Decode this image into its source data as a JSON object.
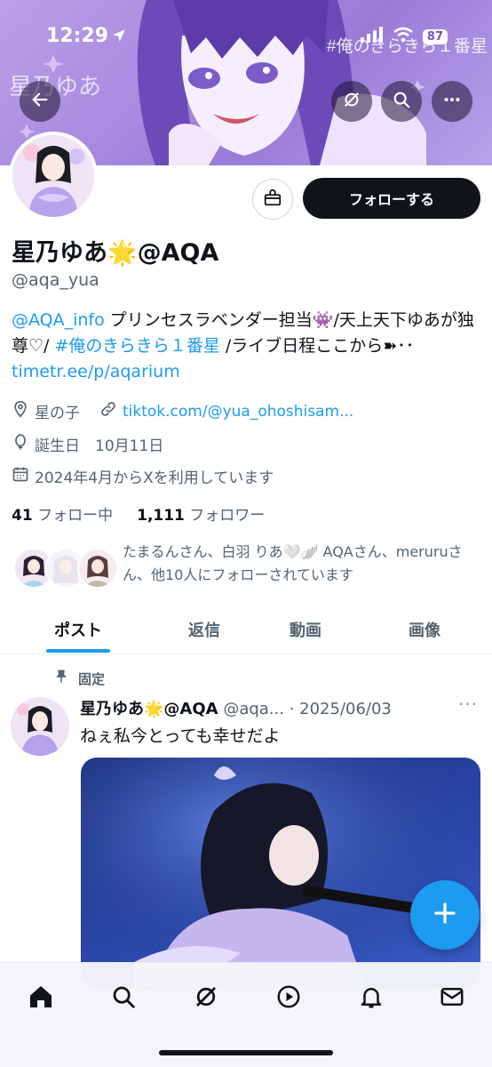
{
  "status_bar": {
    "time": "12:29",
    "battery": "87"
  },
  "profile": {
    "display_name": "星乃ゆあ🌟@AQA",
    "handle": "@aqa_yua",
    "follow_label": "フォローする",
    "bio": {
      "mention": "@AQA_info",
      "part1": " プリンセスラベンダー担当👾/天上天下ゆあが独尊♡/ ",
      "hashtag": "#俺のきらきら１番星",
      "part2": " /ライブ日程ここから➽･･",
      "url": "timetr.ee/p/aqarium"
    },
    "location": "星の子",
    "website": "tiktok.com/@yua_ohoshisam...",
    "birthday": "誕生日　10月11日",
    "joined": "2024年4月からXを利用しています",
    "following_count": "41",
    "following_label": "フォロー中",
    "followers_count": "1,111",
    "followers_label": "フォロワー",
    "known_followers": "たまるんさん、白羽 りあ🤍🪽 AQAさん、meruruさん、他10人にフォローされています"
  },
  "tabs": [
    {
      "label": "ポスト"
    },
    {
      "label": "返信"
    },
    {
      "label": "動画"
    },
    {
      "label": "画像"
    }
  ],
  "post": {
    "pinned_label": "固定",
    "author": "星乃ゆあ🌟@AQA",
    "handle_date": "@aqa... · 2025/06/03",
    "more": "···",
    "text": "ねぇ私今とっても幸せだよ"
  },
  "banner_text": {
    "hashtag": "#俺のきらきら１番星",
    "name": "星乃ゆあ"
  },
  "colors": {
    "accent": "#1d9bf0",
    "text": "#0f1419",
    "muted": "#536471",
    "banner": "#a98be0"
  },
  "icons": {
    "back": "back-arrow-icon",
    "grok": "grok-icon",
    "search": "search-icon",
    "more": "more-icon",
    "gift": "gift-icon",
    "location": "location-icon",
    "link": "link-icon",
    "birthday": "balloon-icon",
    "calendar": "calendar-icon",
    "pin": "pin-icon",
    "compose": "plus-icon",
    "nav": [
      "home-icon",
      "search-icon",
      "grok-icon",
      "video-icon",
      "bell-icon",
      "mail-icon"
    ]
  }
}
